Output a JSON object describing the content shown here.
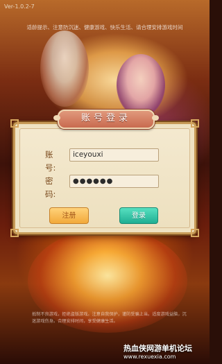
{
  "version": "Ver-1.0.2-7",
  "notice": "适龄提示、注意防沉迷、健康游戏、快乐生活、请合理安排游戏时间",
  "dialog": {
    "title": "账号登录",
    "account_label": "账号:",
    "account_value": "iceyouxi",
    "password_label": "密码:",
    "password_value": "●●●●●●",
    "register_label": "注册",
    "login_label": "登录"
  },
  "disclaimer": "抵制不良游戏，拒绝盗版游戏。注意自我保护，谨防受骗上当。适度游戏益脑，沉迷游戏伤身。合理安排时间，享受健康生活。",
  "watermark": {
    "line1": "热血侠网游单机论坛",
    "line2": "www.rexuexia.com"
  }
}
